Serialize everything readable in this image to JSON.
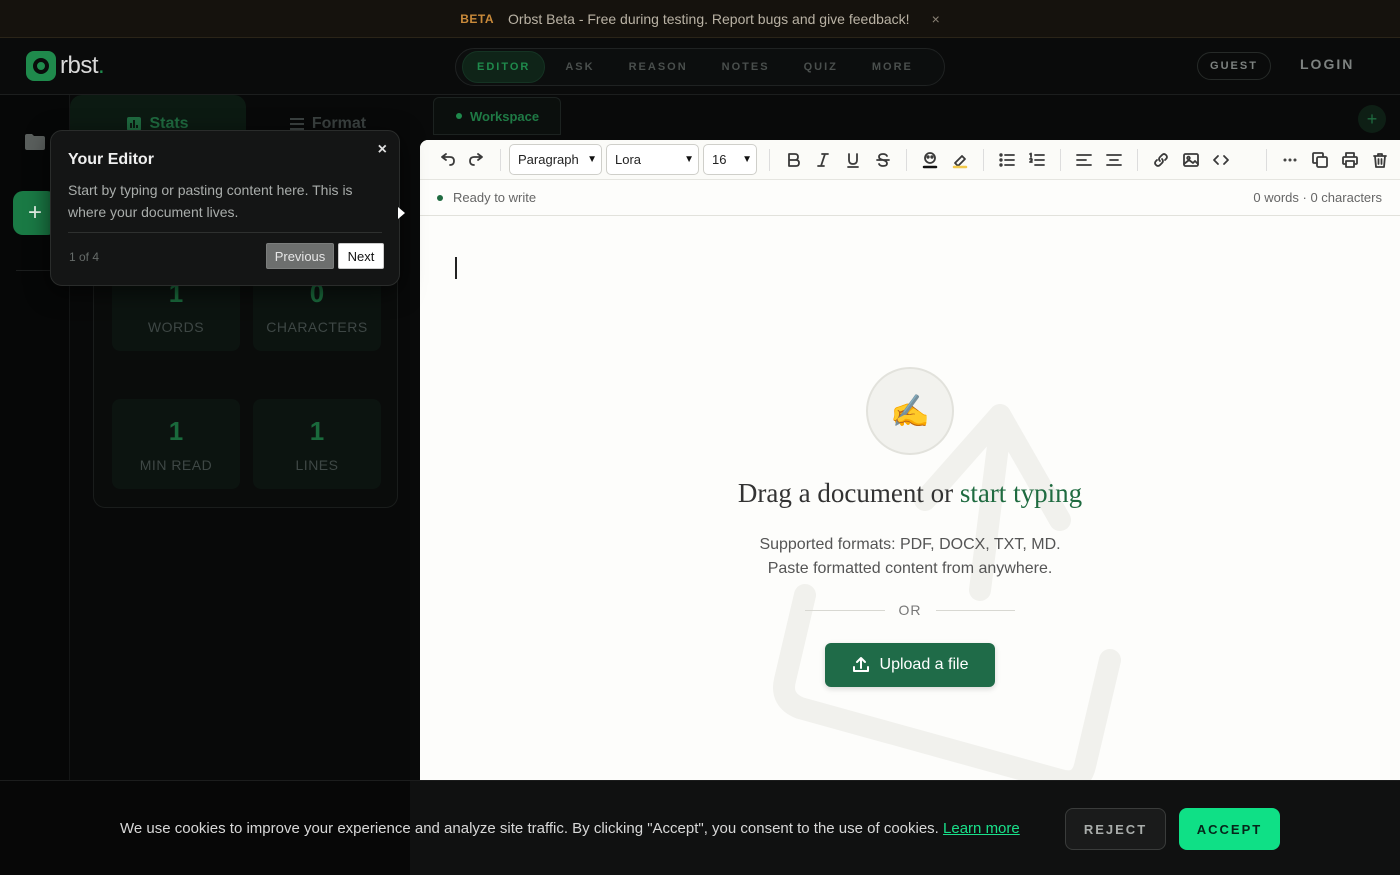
{
  "beta_banner": {
    "tag": "BETA",
    "text": "Orbst Beta - Free during testing. Report bugs and give feedback!",
    "close": "×"
  },
  "header": {
    "logo_text": "rbst",
    "logo_dot": ".",
    "nav": [
      {
        "label": "EDITOR",
        "active": true
      },
      {
        "label": "ASK",
        "active": false
      },
      {
        "label": "REASON",
        "active": false
      },
      {
        "label": "NOTES",
        "active": false
      },
      {
        "label": "QUIZ",
        "active": false
      },
      {
        "label": "MORE",
        "active": false
      }
    ],
    "guest_label": "GUEST",
    "login_label": "LOGIN"
  },
  "rail": {
    "add_label": "+"
  },
  "side_panel": {
    "tabs": [
      {
        "label": "Stats",
        "icon": "bar-chart-icon",
        "active": true
      },
      {
        "label": "Format",
        "icon": "list-icon",
        "active": false
      }
    ],
    "stats": [
      {
        "value": "1",
        "label": "WORDS"
      },
      {
        "value": "0",
        "label": "CHARACTERS"
      },
      {
        "value": "1",
        "label": "MIN READ"
      },
      {
        "value": "1",
        "label": "LINES"
      }
    ]
  },
  "workspace": {
    "tab_label": "Workspace",
    "add_label": "+"
  },
  "toolbar": {
    "block_type": "Paragraph",
    "font": "Lora",
    "size": "16"
  },
  "status": {
    "left": "Ready to write",
    "right": "0 words · 0 characters"
  },
  "dropzone": {
    "icon": "✍️",
    "title_prefix": "Drag a document or ",
    "title_accent": "start typing",
    "sub_line1": "Supported formats: PDF, DOCX, TXT, MD.",
    "sub_line2": "Paste formatted content from anywhere.",
    "or_label": "OR",
    "upload_label": "Upload a file"
  },
  "tour": {
    "title": "Your Editor",
    "text": "Start by typing or pasting content here. This is where your document lives.",
    "count": "1 of 4",
    "prev_label": "Previous",
    "next_label": "Next",
    "close": "×"
  },
  "cookie": {
    "text": "We use cookies to improve your experience and analyze site traffic. By clicking \"Accept\", you consent to the use of cookies.",
    "link": "Learn more",
    "reject_label": "REJECT",
    "accept_label": "ACCEPT"
  },
  "colors": {
    "accent": "#1f6b48",
    "accept": "#0fe086",
    "beta": "#c98a3a"
  }
}
